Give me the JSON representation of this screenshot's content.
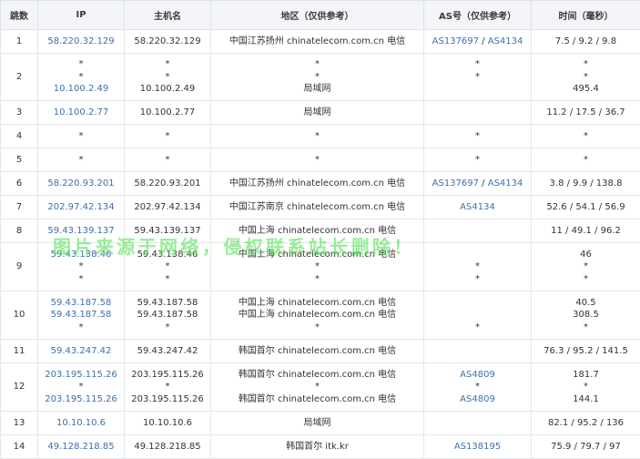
{
  "headers": [
    "跳数",
    "IP",
    "主机名",
    "地区（仅供参考）",
    "AS号（仅供参考）",
    "时间（毫秒）"
  ],
  "rows": [
    {
      "hop": "1",
      "ip": [
        "58.220.32.129"
      ],
      "host": [
        "58.220.32.129"
      ],
      "region": [
        "中国江苏扬州 chinatelecom.com.cn 电信"
      ],
      "asn": [
        [
          "AS137697",
          "AS4134"
        ]
      ],
      "time": [
        "7.5 / 9.2 / 9.8"
      ]
    },
    {
      "hop": "2",
      "ip": [
        "*",
        "*",
        "10.100.2.49"
      ],
      "host": [
        "*",
        "*",
        "10.100.2.49"
      ],
      "region": [
        "*",
        "*",
        "局域网"
      ],
      "asn": [
        "*",
        "*",
        ""
      ],
      "time": [
        "*",
        "*",
        "495.4"
      ]
    },
    {
      "hop": "3",
      "ip": [
        "10.100.2.77"
      ],
      "host": [
        "10.100.2.77"
      ],
      "region": [
        "局域网"
      ],
      "asn": [
        ""
      ],
      "time": [
        "11.2 / 17.5 / 36.7"
      ]
    },
    {
      "hop": "4",
      "ip": [
        "*"
      ],
      "host": [
        "*"
      ],
      "region": [
        "*"
      ],
      "asn": [
        "*"
      ],
      "time": [
        "*"
      ]
    },
    {
      "hop": "5",
      "ip": [
        "*"
      ],
      "host": [
        "*"
      ],
      "region": [
        "*"
      ],
      "asn": [
        "*"
      ],
      "time": [
        "*"
      ]
    },
    {
      "hop": "6",
      "ip": [
        "58.220.93.201"
      ],
      "host": [
        "58.220.93.201"
      ],
      "region": [
        "中国江苏扬州 chinatelecom.com.cn 电信"
      ],
      "asn": [
        [
          "AS137697",
          "AS4134"
        ]
      ],
      "time": [
        "3.8 / 9.9 / 138.8"
      ]
    },
    {
      "hop": "7",
      "ip": [
        "202.97.42.134"
      ],
      "host": [
        "202.97.42.134"
      ],
      "region": [
        "中国江苏南京 chinatelecom.com.cn 电信"
      ],
      "asn": [
        [
          "AS4134"
        ]
      ],
      "time": [
        "52.6 / 54.1 / 56.9"
      ]
    },
    {
      "hop": "8",
      "ip": [
        "59.43.139.137"
      ],
      "host": [
        "59.43.139.137"
      ],
      "region": [
        "中国上海 chinatelecom.com.cn 电信"
      ],
      "asn": [
        ""
      ],
      "time": [
        "11 / 49.1 / 96.2"
      ]
    },
    {
      "hop": "9",
      "ip": [
        "59.43.138.46",
        "*",
        "*"
      ],
      "host": [
        "59.43.138.46",
        "*",
        "*"
      ],
      "region": [
        "中国上海 chinatelecom.com.cn 电信",
        "*",
        "*"
      ],
      "asn": [
        "",
        "*",
        "*"
      ],
      "time": [
        "46",
        "*",
        "*"
      ]
    },
    {
      "hop": "10",
      "ip": [
        "59.43.187.58",
        "59.43.187.58",
        "*"
      ],
      "host": [
        "59.43.187.58",
        "59.43.187.58",
        "*"
      ],
      "region": [
        "中国上海 chinatelecom.com.cn 电信",
        "中国上海 chinatelecom.com.cn 电信",
        "*"
      ],
      "asn": [
        "",
        "",
        "*"
      ],
      "time": [
        "40.5",
        "308.5",
        "*"
      ]
    },
    {
      "hop": "11",
      "ip": [
        "59.43.247.42"
      ],
      "host": [
        "59.43.247.42"
      ],
      "region": [
        "韩国首尔 chinatelecom.com.cn 电信"
      ],
      "asn": [
        ""
      ],
      "time": [
        "76.3 / 95.2 / 141.5"
      ]
    },
    {
      "hop": "12",
      "ip": [
        "203.195.115.26",
        "*",
        "203.195.115.26"
      ],
      "host": [
        "203.195.115.26",
        "*",
        "203.195.115.26"
      ],
      "region": [
        "韩国首尔 chinatelecom.com.cn 电信",
        "*",
        "韩国首尔 chinatelecom.com.cn 电信"
      ],
      "asn": [
        [
          "AS4809"
        ],
        "*",
        [
          "AS4809"
        ]
      ],
      "time": [
        "181.7",
        "*",
        "144.1"
      ]
    },
    {
      "hop": "13",
      "ip": [
        "10.10.10.6"
      ],
      "host": [
        "10.10.10.6"
      ],
      "region": [
        "局域网"
      ],
      "asn": [
        ""
      ],
      "time": [
        "82.1 / 95.2 / 136"
      ]
    },
    {
      "hop": "14",
      "ip": [
        "49.128.218.85"
      ],
      "host": [
        "49.128.218.85"
      ],
      "region": [
        "韩国首尔 itk.kr"
      ],
      "asn": [
        [
          "AS138195"
        ]
      ],
      "time": [
        "75.9 / 79.7 / 97"
      ]
    }
  ],
  "asn_separator": " / ",
  "watermark": "图片来源于网络，侵权联系站长删除！",
  "colors": {
    "link": "#3d6fb0",
    "header_bg": "#f3f5f8",
    "border": "#e4e7eb",
    "watermark": "#58e258"
  }
}
